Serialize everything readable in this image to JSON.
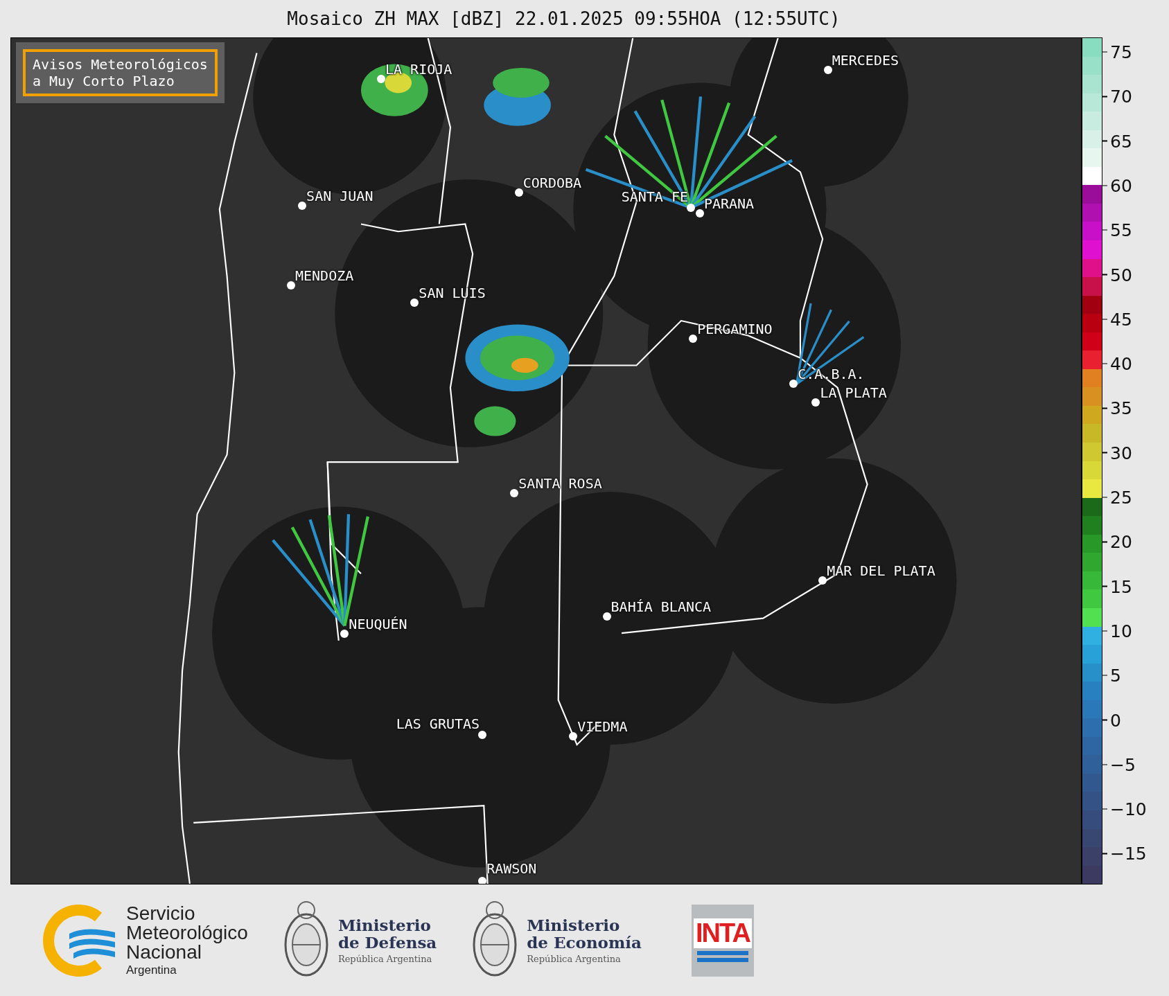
{
  "title": "Mosaico ZH MAX [dBZ] 22.01.2025 09:55HOA (12:55UTC)",
  "notice": [
    "Avisos Meteorológicos",
    "a Muy Corto Plazo"
  ],
  "cities": [
    {
      "name": "LA RIOJA"
    },
    {
      "name": "MERCEDES"
    },
    {
      "name": "CORDOBA"
    },
    {
      "name": "SAN JUAN"
    },
    {
      "name": "SANTA FE"
    },
    {
      "name": "PARANA"
    },
    {
      "name": "MENDOZA"
    },
    {
      "name": "SAN LUIS"
    },
    {
      "name": "PERGAMINO"
    },
    {
      "name": "C.A.B.A."
    },
    {
      "name": "LA PLATA"
    },
    {
      "name": "SANTA ROSA"
    },
    {
      "name": "MAR DEL PLATA"
    },
    {
      "name": "BAHÍA BLANCA"
    },
    {
      "name": "NEUQUÉN"
    },
    {
      "name": "LAS GRUTAS"
    },
    {
      "name": "VIEDMA"
    },
    {
      "name": "RAWSON"
    }
  ],
  "colorbar": {
    "ticks": [
      "75",
      "70",
      "65",
      "60",
      "55",
      "50",
      "45",
      "40",
      "35",
      "30",
      "25",
      "20",
      "15",
      "10",
      "5",
      "0",
      "−5",
      "−10",
      "−15"
    ]
  },
  "footer": {
    "smn": {
      "lines": [
        "Servicio",
        "Meteorológico",
        "Nacional"
      ],
      "country": "Argentina"
    },
    "ministries": [
      {
        "lines": [
          "Ministerio",
          "de Defensa"
        ],
        "country": "República Argentina"
      },
      {
        "lines": [
          "Ministerio",
          "de Economía"
        ],
        "country": "República Argentina"
      }
    ],
    "inta": "INTA"
  }
}
